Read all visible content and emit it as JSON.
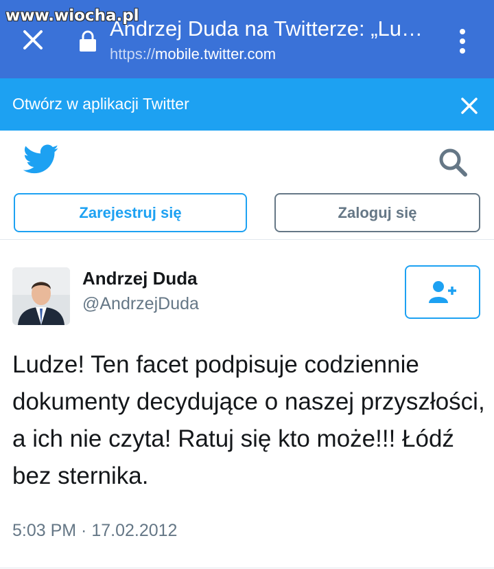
{
  "watermark": "www.wiocha.pl",
  "browser": {
    "title": "Andrzej Duda na Twitterze: „Lu…",
    "url_scheme": "https://",
    "url_host": "mobile.twitter.com"
  },
  "app_banner": {
    "label": "Otwórz w aplikacji Twitter"
  },
  "auth": {
    "signup_label": "Zarejestruj się",
    "login_label": "Zaloguj się"
  },
  "tweet": {
    "author_name": "Andrzej Duda",
    "author_handle": "@AndrzejDuda",
    "text": "Ludze! Ten facet podpisuje codziennie dokumenty decydujące o naszej przyszłości, a ich nie czyta! Ratuj się kto może!!! Łódź bez sternika.",
    "timestamp": "5:03 PM · 17.02.2012"
  },
  "icons": {
    "close_tab": "close-icon",
    "lock": "lock-icon",
    "menu": "more-vert-icon",
    "banner_close": "close-icon",
    "logo": "twitter-bird-icon",
    "search": "search-icon",
    "follow": "follow-user-icon"
  },
  "colors": {
    "browser_bar": "#3a72d8",
    "twitter_blue": "#1da1f2",
    "gray_text": "#657786",
    "divider": "#e1e8ed"
  }
}
